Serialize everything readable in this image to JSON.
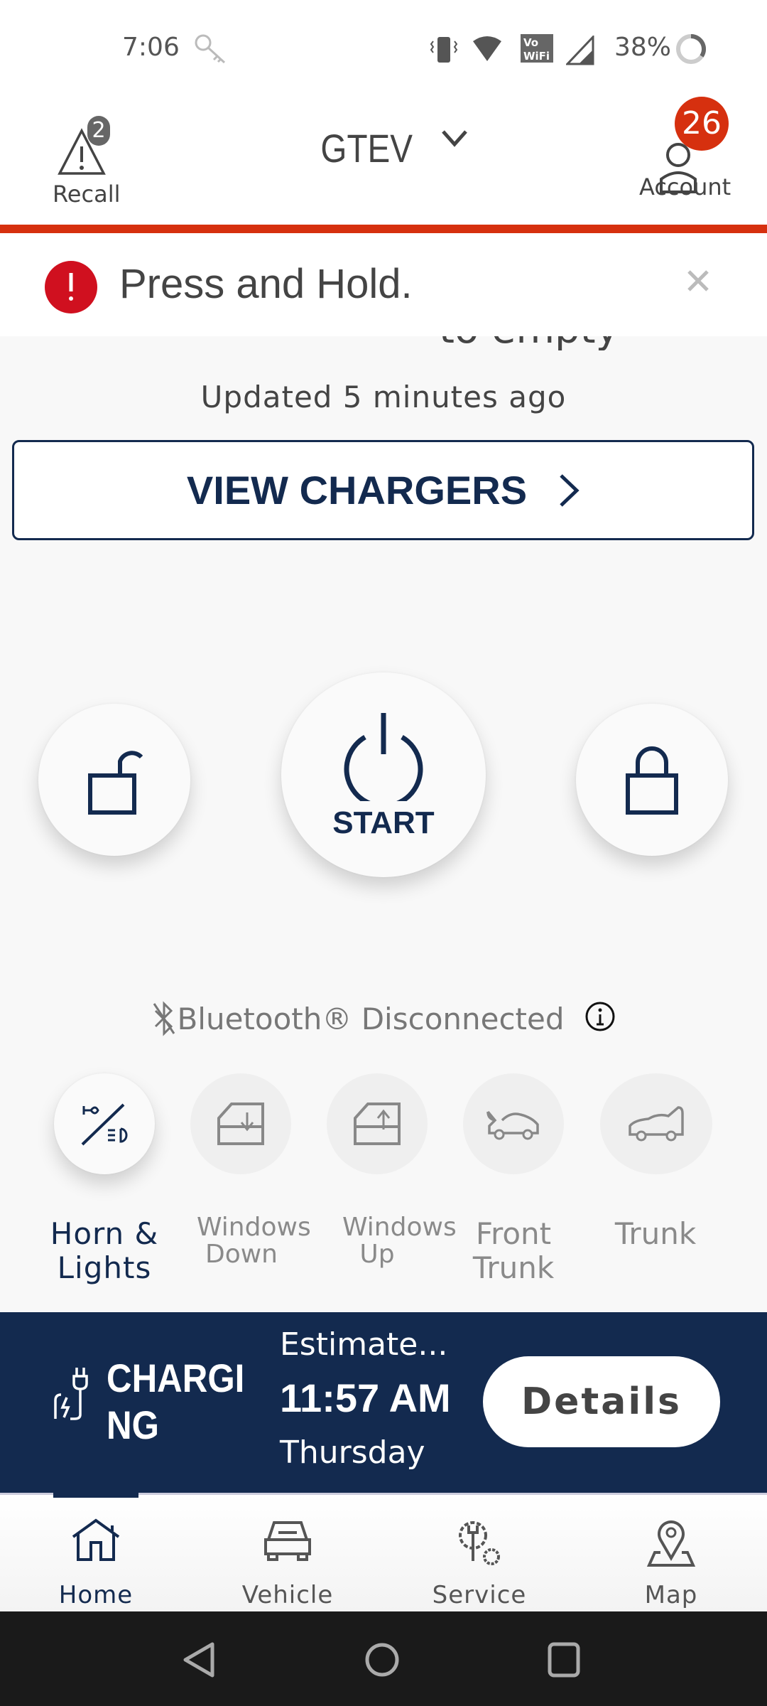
{
  "status_bar": {
    "time": "7:06",
    "battery": "38%",
    "icons": [
      "key-icon",
      "vibrate-icon",
      "wifi-icon",
      "vowifi-icon",
      "signal-icon",
      "battery-icon"
    ]
  },
  "header": {
    "recall_label": "Recall",
    "recall_badge": "2",
    "vehicle_name": "GTEV",
    "account_label": "Account",
    "account_badge": "26"
  },
  "banner": {
    "message": "Press and Hold.",
    "icon": "alert-icon"
  },
  "main": {
    "clipped_text": "to empty",
    "updated": "Updated 5 minutes ago",
    "view_chargers": "VIEW CHARGERS",
    "start_label": "START",
    "bluetooth": "Bluetooth® Disconnected"
  },
  "quick_actions": [
    {
      "label": "Horn & Lights"
    },
    {
      "label": "Windows Down"
    },
    {
      "label": "Windows Up"
    },
    {
      "label": "Front Trunk"
    },
    {
      "label": "Trunk"
    }
  ],
  "charging": {
    "status": "CHARGING",
    "estimate_label": "Estimate...",
    "time": "11:57 AM",
    "day": "Thursday",
    "details": "Details"
  },
  "bottom_nav": [
    {
      "label": "Home",
      "active": true
    },
    {
      "label": "Vehicle"
    },
    {
      "label": "Service"
    },
    {
      "label": "Map"
    }
  ],
  "colors": {
    "navy": "#132a4f",
    "red": "#d6300f",
    "alert": "#d0101f"
  }
}
